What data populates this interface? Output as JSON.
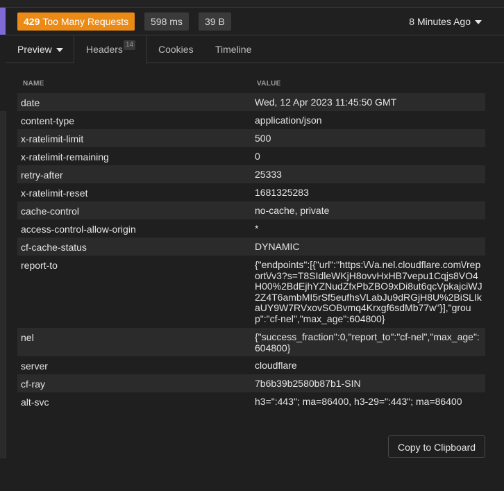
{
  "status": {
    "code": "429",
    "text": "Too Many Requests"
  },
  "timing": "598 ms",
  "size": "39 B",
  "time_ago": "8 Minutes Ago",
  "tabs": {
    "preview": "Preview",
    "headers": "Headers",
    "headers_count": "14",
    "cookies": "Cookies",
    "timeline": "Timeline"
  },
  "table": {
    "col_name": "NAME",
    "col_value": "VALUE",
    "rows": [
      {
        "name": "date",
        "value": "Wed, 12 Apr 2023 11:45:50 GMT"
      },
      {
        "name": "content-type",
        "value": "application/json"
      },
      {
        "name": "x-ratelimit-limit",
        "value": "500"
      },
      {
        "name": "x-ratelimit-remaining",
        "value": "0"
      },
      {
        "name": "retry-after",
        "value": "25333"
      },
      {
        "name": "x-ratelimit-reset",
        "value": "1681325283"
      },
      {
        "name": "cache-control",
        "value": "no-cache, private"
      },
      {
        "name": "access-control-allow-origin",
        "value": "*"
      },
      {
        "name": "cf-cache-status",
        "value": "DYNAMIC"
      },
      {
        "name": "report-to",
        "value": "{\"endpoints\":[{\"url\":\"https:\\/\\/a.nel.cloudflare.com\\/report\\/v3?s=T8SIdleWKjH8ovvHxHB7vepu1Cqjs8VO4H00%2BdEjhYZNudZfxPbZBO9xDi8ut6qcVpkajciWJ2Z4T6ambMI5rSf5eufhsVLabJu9dRGjH8U%2BiSLIkaUY9W7RVxovSOBvmq4Krxgf6sdMb77w\"}],\"group\":\"cf-nel\",\"max_age\":604800}"
      },
      {
        "name": "nel",
        "value": "{\"success_fraction\":0,\"report_to\":\"cf-nel\",\"max_age\":604800}"
      },
      {
        "name": "server",
        "value": "cloudflare"
      },
      {
        "name": "cf-ray",
        "value": "7b6b39b2580b87b1-SIN"
      },
      {
        "name": "alt-svc",
        "value": "h3=\":443\"; ma=86400, h3-29=\":443\"; ma=86400"
      }
    ]
  },
  "copy_button": "Copy to Clipboard"
}
